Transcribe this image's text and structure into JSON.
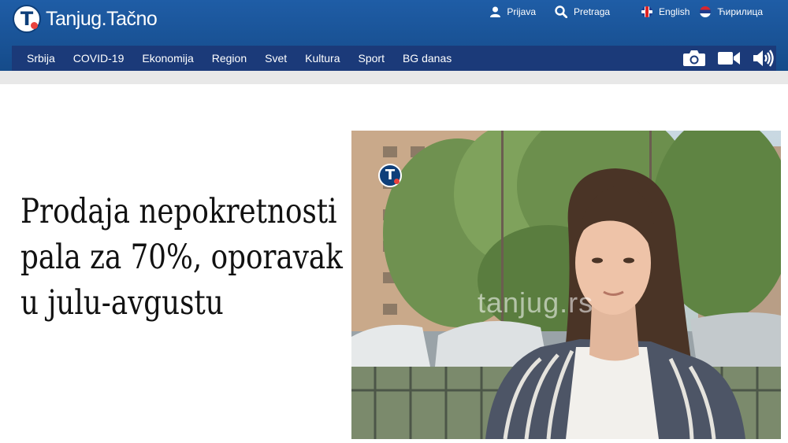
{
  "brand": {
    "name": "Tanjug.Tačno",
    "logo_letter": "T"
  },
  "top_links": {
    "login": {
      "label": "Prijava",
      "icon": "user-icon"
    },
    "search": {
      "label": "Pretraga",
      "icon": "search-icon"
    },
    "english": {
      "label": "English",
      "icon": "uk-flag-icon"
    },
    "cyrillic": {
      "label": "Ћирилица",
      "icon": "serbia-flag-icon"
    }
  },
  "nav": {
    "items": [
      {
        "label": "Srbija"
      },
      {
        "label": "COVID-19"
      },
      {
        "label": "Ekonomija"
      },
      {
        "label": "Region"
      },
      {
        "label": "Svet"
      },
      {
        "label": "Kultura"
      },
      {
        "label": "Sport"
      },
      {
        "label": "BG danas"
      }
    ],
    "media": [
      {
        "icon": "camera-icon"
      },
      {
        "icon": "video-camera-icon"
      },
      {
        "icon": "speaker-icon"
      }
    ]
  },
  "article": {
    "headline_lines": [
      "Prodaja nepokretnosti",
      "pala za 70%, oporavak",
      "u  julu-avgustu"
    ],
    "photo_watermark": "tanjug.rs"
  },
  "colors": {
    "header_blue": "#1f5da6",
    "nav_blue": "#1b3a79",
    "accent_red": "#e8423c"
  }
}
